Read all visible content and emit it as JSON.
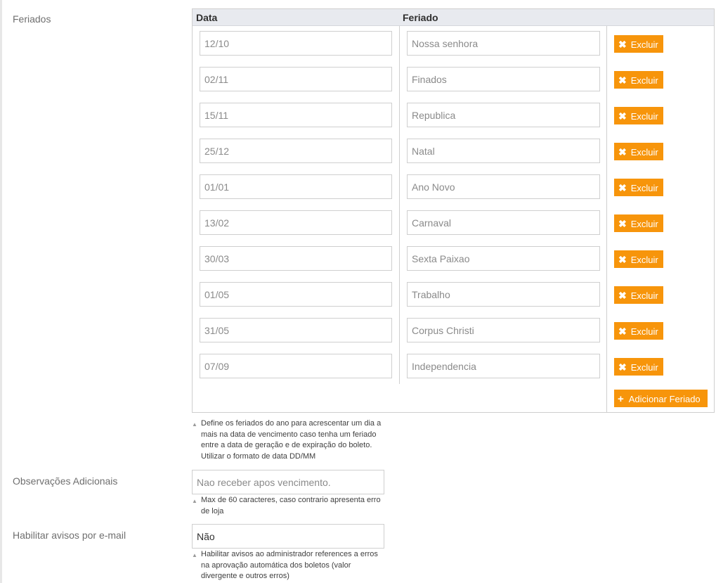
{
  "holidays": {
    "label": "Feriados",
    "columns": {
      "date": "Data",
      "name": "Feriado"
    },
    "rows": [
      {
        "date": "12/10",
        "name": "Nossa senhora",
        "delete_label": "Excluir"
      },
      {
        "date": "02/11",
        "name": "Finados",
        "delete_label": "Excluir"
      },
      {
        "date": "15/11",
        "name": "Republica",
        "delete_label": "Excluir"
      },
      {
        "date": "25/12",
        "name": "Natal",
        "delete_label": "Excluir"
      },
      {
        "date": "01/01",
        "name": "Ano Novo",
        "delete_label": "Excluir"
      },
      {
        "date": "13/02",
        "name": "Carnaval",
        "delete_label": "Excluir"
      },
      {
        "date": "30/03",
        "name": "Sexta Paixao",
        "delete_label": "Excluir"
      },
      {
        "date": "01/05",
        "name": "Trabalho",
        "delete_label": "Excluir"
      },
      {
        "date": "31/05",
        "name": "Corpus Christi",
        "delete_label": "Excluir"
      },
      {
        "date": "07/09",
        "name": "Independencia",
        "delete_label": "Excluir"
      }
    ],
    "add_label": "Adicionar Feriado",
    "hint_lines": [
      "Define os feriados do ano para acrescentar um dia a",
      "mais na data de vencimento caso tenha um feriado",
      "entre a data de geração e de expiração do boleto.",
      "Utilizar o formato de data DD/MM"
    ]
  },
  "observations": {
    "label": "Observações Adicionais",
    "value": "Nao receber apos vencimento.",
    "hint_lines": [
      "Max de 60 caracteres, caso contrario apresenta erro",
      "de loja"
    ]
  },
  "email_alerts": {
    "label": "Habilitar avisos por e-mail",
    "value": "Não",
    "hint_lines": [
      "Habilitar avisos ao administrador references a erros",
      "na aprovação automática dos boletos (valor",
      "divergente e outros erros)"
    ]
  },
  "icons": {
    "delete": "close-icon",
    "add": "plus-icon",
    "hint": "triangle-up-icon"
  },
  "colors": {
    "button": "#f7950b",
    "header_bg": "#e8eaef",
    "border": "#cfcfcf"
  }
}
